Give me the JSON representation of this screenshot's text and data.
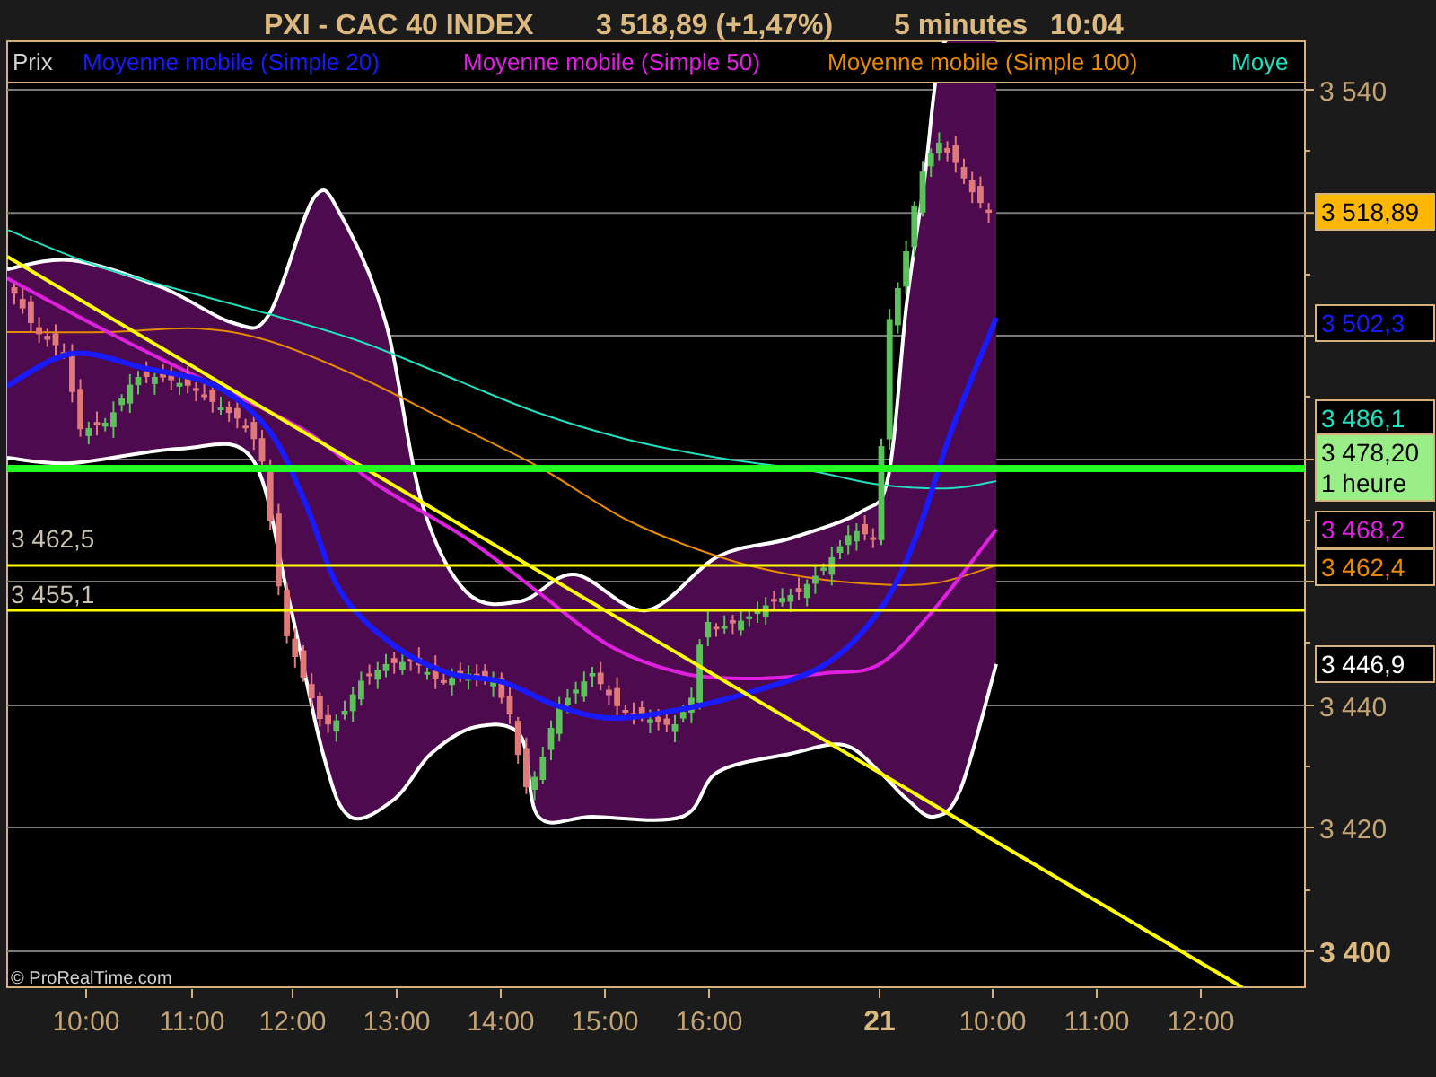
{
  "title": {
    "instrument": "PXI - CAC 40 INDEX",
    "last_price": "3 518,89 (+1,47%)",
    "timeframe": "5 minutes",
    "time": "10:04"
  },
  "legend": [
    {
      "label": "Prix",
      "color": "#d0d0d0"
    },
    {
      "label": "Moyenne mobile (Simple 20)",
      "color": "#1a1aff"
    },
    {
      "label": "Moyenne mobile (Simple 50)",
      "color": "#e020e0"
    },
    {
      "label": "Moyenne mobile (Simple 100)",
      "color": "#e88a00"
    },
    {
      "label": "Moye",
      "color": "#20e0c0"
    }
  ],
  "level_labels": [
    "3 462,5",
    "3 455,1"
  ],
  "price_axis": [
    {
      "label": "3 540",
      "emphasis": false
    },
    {
      "label": "3 440",
      "emphasis": false
    },
    {
      "label": "3 420",
      "emphasis": false
    },
    {
      "label": "3 400",
      "emphasis": true
    }
  ],
  "value_markers": [
    {
      "kind": "filled",
      "color": "#ffb800",
      "lines": [
        "3 518,89"
      ]
    },
    {
      "kind": "outline",
      "color": "#1a1aff",
      "lines": [
        "3 502,3"
      ]
    },
    {
      "kind": "outline",
      "color": "#20e0c0",
      "lines": [
        "3 486,1"
      ]
    },
    {
      "kind": "filled",
      "color": "#99ee88",
      "lines": [
        "3 478,20",
        "1 heure"
      ]
    },
    {
      "kind": "outline",
      "color": "#e020e0",
      "lines": [
        "3 468,2"
      ]
    },
    {
      "kind": "outline",
      "color": "#e88a00",
      "lines": [
        "3 462,4"
      ]
    },
    {
      "kind": "outline",
      "color": "#ffffff",
      "lines": [
        "3 446,9"
      ]
    }
  ],
  "time_axis": [
    {
      "label": "10:00",
      "kind": "time"
    },
    {
      "label": "11:00",
      "kind": "time"
    },
    {
      "label": "12:00",
      "kind": "time"
    },
    {
      "label": "13:00",
      "kind": "time"
    },
    {
      "label": "14:00",
      "kind": "time"
    },
    {
      "label": "15:00",
      "kind": "time"
    },
    {
      "label": "16:00",
      "kind": "time"
    },
    {
      "label": "21",
      "kind": "day"
    },
    {
      "label": "10:00",
      "kind": "time"
    },
    {
      "label": "11:00",
      "kind": "time"
    },
    {
      "label": "12:00",
      "kind": "time"
    }
  ],
  "copyright": "© ProRealTime.com"
}
